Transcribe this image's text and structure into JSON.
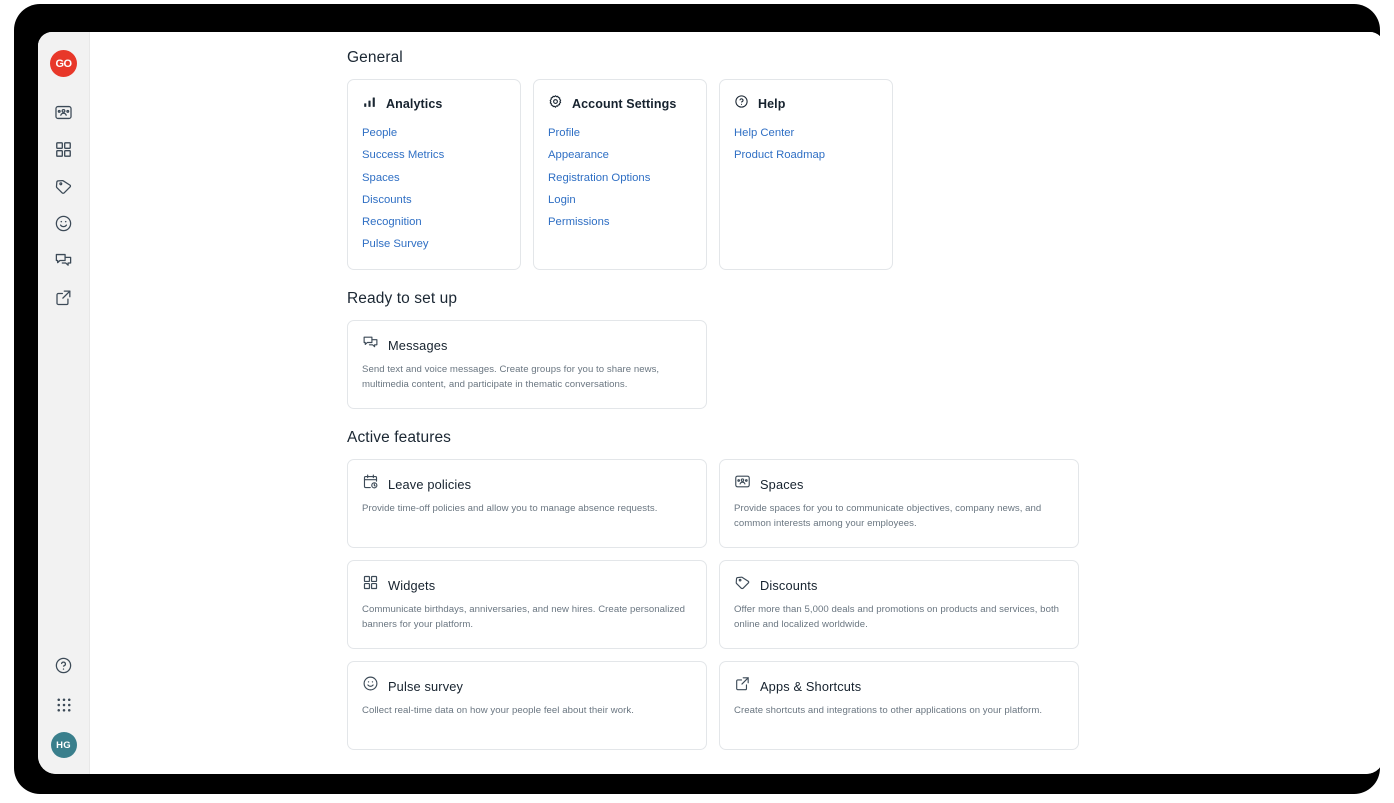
{
  "brand": {
    "logo_text": "GO",
    "logo_color": "#e8382a",
    "avatar_initials": "HG",
    "avatar_color": "#3a7f8c",
    "link_color": "#2f6fc4"
  },
  "sidebar": {
    "items": [
      {
        "name": "spaces",
        "icon": "spaces-icon",
        "label": "Spaces"
      },
      {
        "name": "widgets",
        "icon": "widgets-grid-icon",
        "label": "Widgets"
      },
      {
        "name": "discounts",
        "icon": "tag-icon",
        "label": "Discounts"
      },
      {
        "name": "pulse-survey",
        "icon": "smiley-icon",
        "label": "Pulse survey"
      },
      {
        "name": "messages",
        "icon": "messages-icon",
        "label": "Messages"
      },
      {
        "name": "apps-shortcuts",
        "icon": "external-link-icon",
        "label": "Apps & Shortcuts"
      }
    ],
    "bottom_items": [
      {
        "name": "help",
        "icon": "help-circle-icon",
        "label": "Help"
      },
      {
        "name": "apps-launcher",
        "icon": "dot-grid-icon",
        "label": "Apps"
      }
    ]
  },
  "sections": {
    "general": {
      "title": "General",
      "cards": [
        {
          "icon": "bar-chart-icon",
          "title": "Analytics",
          "links": [
            "People",
            "Success Metrics",
            "Spaces",
            "Discounts",
            "Recognition",
            "Pulse Survey"
          ]
        },
        {
          "icon": "gear-icon",
          "title": "Account Settings",
          "links": [
            "Profile",
            "Appearance",
            "Registration Options",
            "Login",
            "Permissions"
          ]
        },
        {
          "icon": "help-circle-icon",
          "title": "Help",
          "links": [
            "Help Center",
            "Product Roadmap"
          ]
        }
      ]
    },
    "ready_to_set_up": {
      "title": "Ready to set up",
      "cards": [
        {
          "icon": "messages-icon",
          "title": "Messages",
          "description": "Send text and voice messages. Create groups for you to share news, multimedia content, and participate in thematic conversations."
        }
      ]
    },
    "active_features": {
      "title": "Active features",
      "cards": [
        {
          "icon": "calendar-clock-icon",
          "title": "Leave policies",
          "description": "Provide time-off policies and allow you to manage absence requests."
        },
        {
          "icon": "spaces-icon",
          "title": "Spaces",
          "description": "Provide spaces for you to communicate objectives, company news, and common interests among your employees."
        },
        {
          "icon": "widgets-grid-icon",
          "title": "Widgets",
          "description": "Communicate birthdays, anniversaries, and new hires. Create personalized banners for your platform."
        },
        {
          "icon": "tag-icon",
          "title": "Discounts",
          "description": "Offer more than 5,000 deals and promotions on products and services, both online and localized worldwide."
        },
        {
          "icon": "smiley-icon",
          "title": "Pulse survey",
          "description": "Collect real-time data on how your people feel about their work."
        },
        {
          "icon": "external-link-icon",
          "title": "Apps & Shortcuts",
          "description": "Create shortcuts and integrations to other applications on your platform."
        }
      ]
    }
  }
}
